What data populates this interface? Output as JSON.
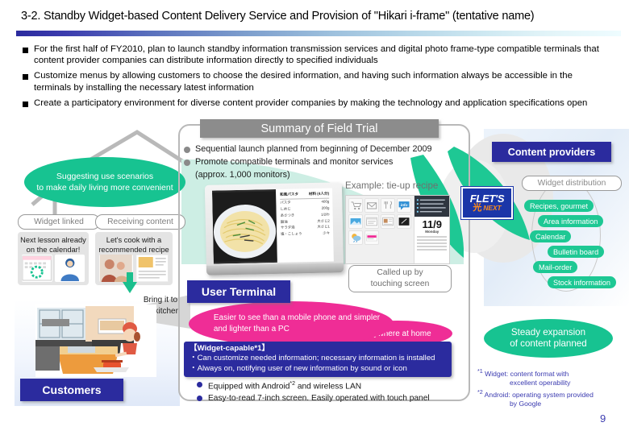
{
  "slide": {
    "title": "3-2. Standby Widget-based Content Delivery Service and Provision of \"Hikari i-frame\" (tentative name)",
    "page_number": "9",
    "accent_navy": "#2b2b9e",
    "accent_green": "#17c391",
    "accent_pink": "#ef2d96",
    "accent_teal_chip": "#1ec894",
    "header_gray": "#8c8c8c"
  },
  "bullets": [
    "For the first half of FY2010, plan to launch standby information transmission services and digital photo frame-type compatible terminals that content provider companies can distribute information directly to specified individuals",
    "Customize menus by allowing customers to choose the desired information, and having such information always be accessible in the terminals by installing the necessary latest information",
    "Create a participatory environment for diverse content provider companies by making the technology and application specifications open"
  ],
  "left": {
    "suggest_ellipse": {
      "line1": "Suggesting use scenarios",
      "line2": "to make daily living more convenient"
    },
    "chips": [
      {
        "name": "widget-linked",
        "label": "Widget linked"
      },
      {
        "name": "receiving-content",
        "label": "Receiving content"
      }
    ],
    "cards": [
      {
        "name": "next-lesson",
        "line1": "Next lesson already",
        "line2": "on the calendar!"
      },
      {
        "name": "cook-recipe",
        "line1": "Let's cook with a",
        "line2": "recommended recipe"
      }
    ],
    "bring_callout": {
      "line1": "Bring it to",
      "line2": "the kitchen"
    },
    "customers_label": "Customers"
  },
  "center": {
    "summary_header": "Summary of Field Trial",
    "summary_points": [
      "Sequential launch planned from beginning of December 2009",
      "Promote compatible terminals and monitor services"
    ],
    "summary_subnote": "(approx. 1,000 monitors)",
    "tablet": {
      "recipe_title": "和風パスタ",
      "recipe_serving": "材料 (4人分)",
      "ingredients": [
        {
          "name": "パスタ",
          "amount": "400g"
        },
        {
          "name": "しめじ",
          "amount": "200g"
        },
        {
          "name": "あさつき",
          "amount": "1/2わ"
        },
        {
          "name": "醤油",
          "amount": "大さじ2"
        },
        {
          "name": "サラダ油",
          "amount": "大さじ1"
        },
        {
          "name": "塩・こしょう",
          "amount": "少々"
        }
      ]
    },
    "example_label": "Example: tie-up recipe",
    "example_widget_date": "11/9",
    "example_widget_day": "Monday",
    "example_info_badge": "info",
    "called_up": {
      "line1": "Called up by",
      "line2": "touching screen"
    },
    "user_terminal_label": "User Terminal",
    "pink_main": {
      "line1": "Easier to see than a mobile phone and simpler",
      "line2": "and lighter than a PC"
    },
    "pink_anywhere": "Anywhere at home",
    "widget_capable": {
      "header": "【Widget-capable*1】",
      "items": [
        "・Can customize needed information; necessary information is installed",
        "・Always on, notifying user of new information by sound or icon"
      ]
    },
    "blue_bullets": [
      {
        "pre": "Equipped with Android",
        "sup": "*2",
        "post": " and wireless LAN"
      },
      {
        "pre": "Easy-to-read 7-inch screen. Easily operated with touch panel",
        "sup": "",
        "post": ""
      }
    ]
  },
  "right": {
    "content_providers_label": "Content providers",
    "widget_distribution_label": "Widget distribution",
    "provider_chips": [
      "Recipes, gourmet",
      "Area information",
      "Calendar",
      "Bulletin board",
      "Mail-order",
      "Stock information"
    ],
    "flets_logo": {
      "brand": "FLET'S",
      "hikari": "光",
      "next": "NEXT"
    },
    "steady_expansion": {
      "line1": "Steady expansion",
      "line2": "of content planned"
    },
    "footnotes": [
      {
        "mark": "*1",
        "line1": " Widget: content format with",
        "line2": "excellent operability"
      },
      {
        "mark": "*2",
        "line1": " Android: operating system provided",
        "line2": "by Google"
      }
    ]
  }
}
